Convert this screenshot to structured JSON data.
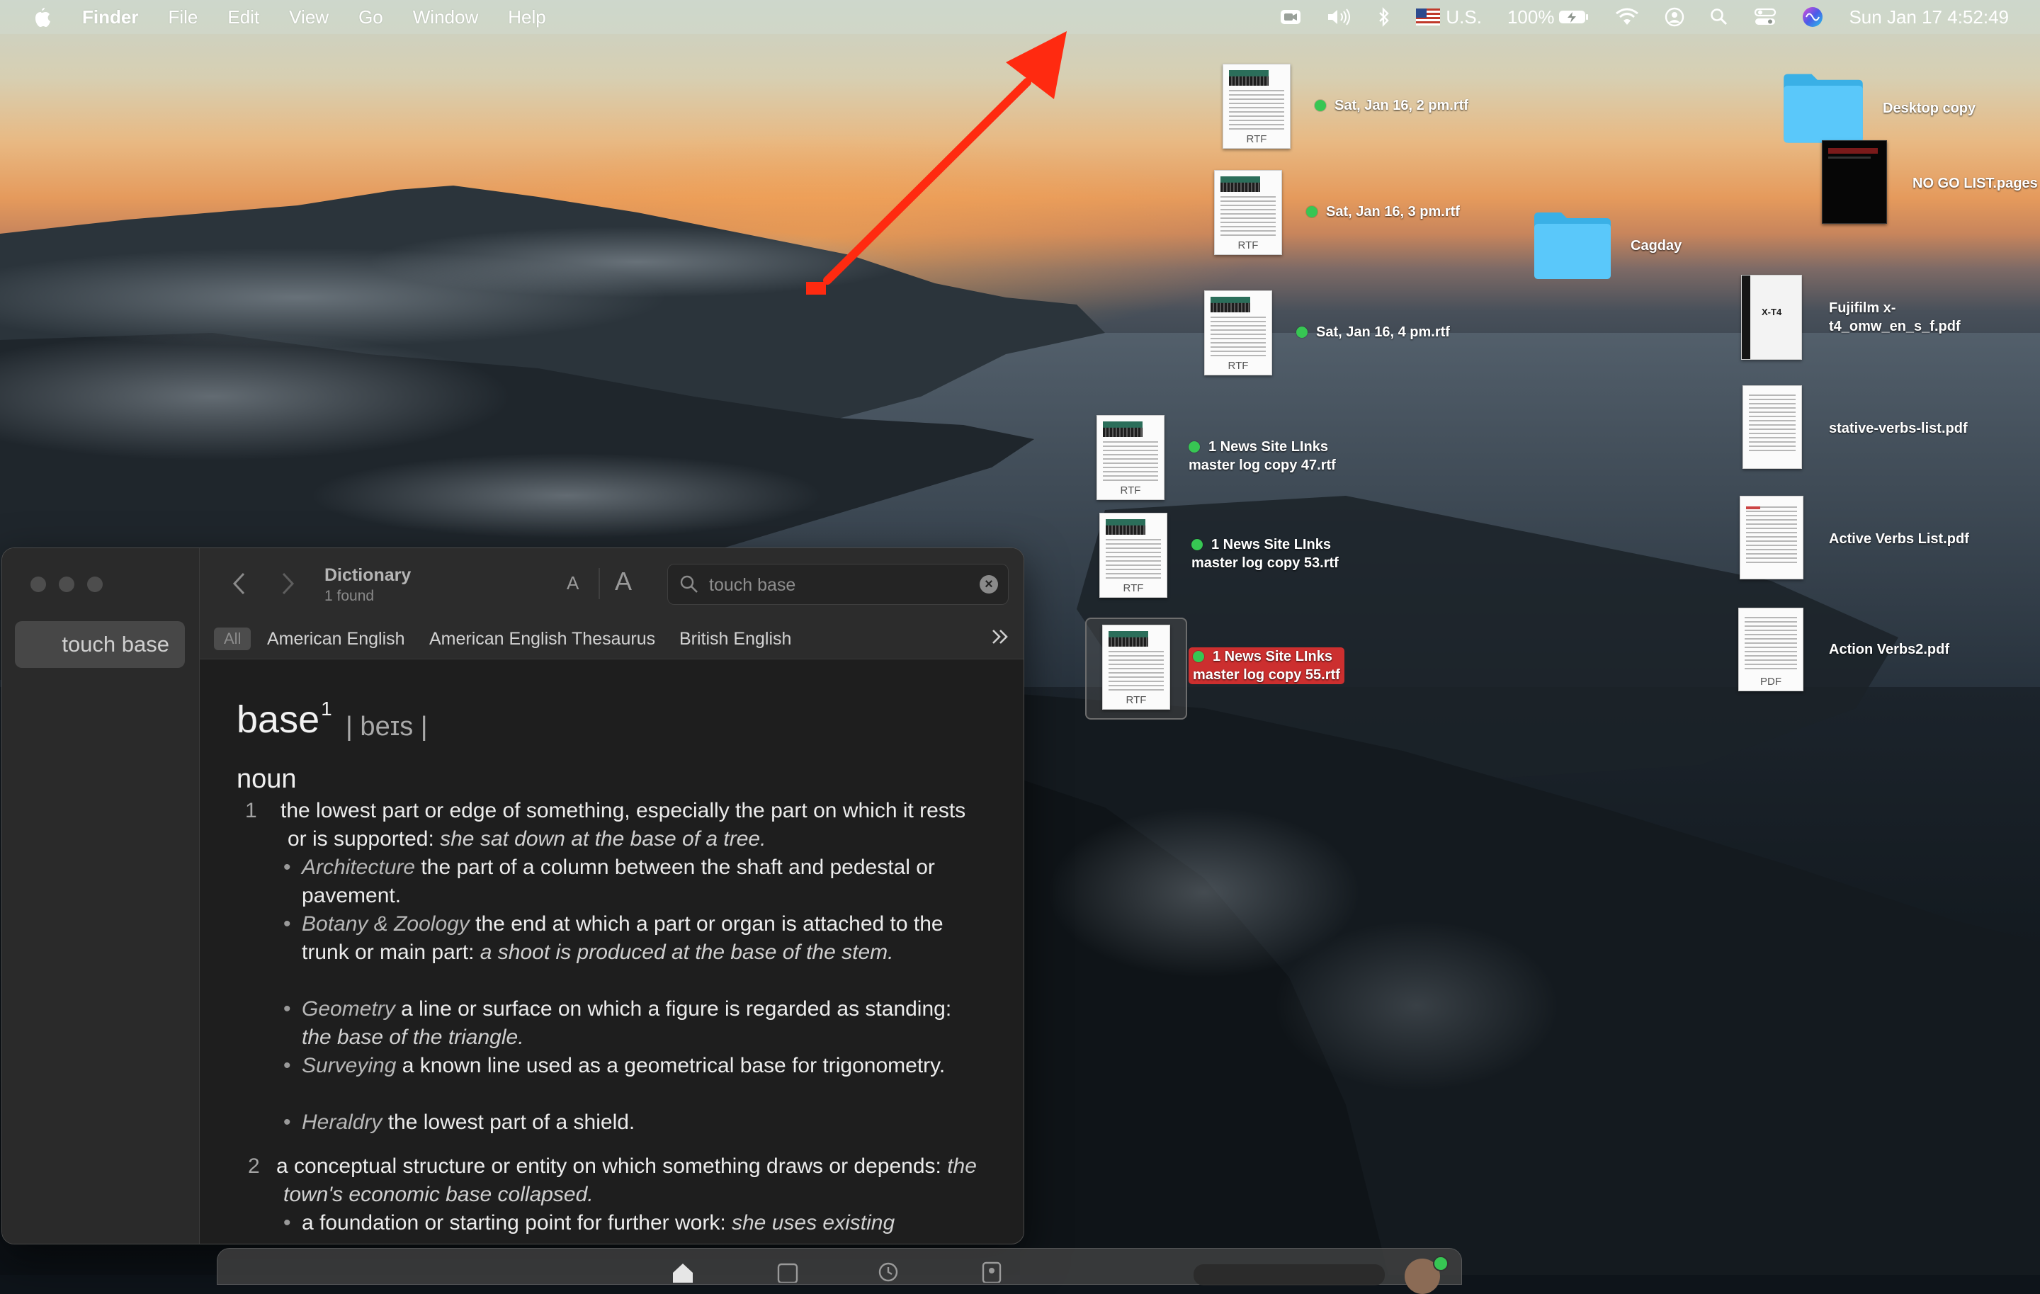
{
  "menubar": {
    "app_name": "Finder",
    "menus": [
      "File",
      "Edit",
      "View",
      "Go",
      "Window",
      "Help"
    ],
    "input_source": "U.S.",
    "battery": "100%",
    "clock": "Sun Jan 17  4:52:49"
  },
  "desktop": {
    "files": [
      {
        "label": "Sat, Jan 16, 2 pm.rtf",
        "ext": "RTF"
      },
      {
        "label": "Sat, Jan 16, 3 pm.rtf",
        "ext": "RTF"
      },
      {
        "label": "Sat, Jan 16, 4 pm.rtf",
        "ext": "RTF"
      },
      {
        "label_line1": "1 News Site LInks",
        "label_line2": "master log copy 47.rtf",
        "ext": "RTF"
      },
      {
        "label_line1": "1 News Site LInks",
        "label_line2": "master log copy 53.rtf",
        "ext": "RTF"
      },
      {
        "label_line1": "1 News Site LInks",
        "label_line2": "master log copy 55.rtf",
        "ext": "RTF"
      }
    ],
    "cagday_folder": "Cagday",
    "desktop_copy_folder": "Desktop copy",
    "no_go_list": "NO GO LIST.pages",
    "fujifilm_line1": "Fujifilm x-",
    "fujifilm_line2": "t4_omw_en_s_f.pdf",
    "fujifilm_thumb_text": "X-T4",
    "stative": "stative-verbs-list.pdf",
    "active": "Active Verbs List.pdf",
    "action": "Action Verbs2.pdf",
    "action_ext": "PDF"
  },
  "dictionary": {
    "sidebar_item": "touch base",
    "title": "Dictionary",
    "subtitle": "1 found",
    "font_small": "A",
    "font_large": "A",
    "search_value": "touch base",
    "tabs": [
      "All",
      "American English",
      "American English Thesaurus",
      "British English"
    ],
    "entry": {
      "headword": "base",
      "homograph": "1",
      "pronunciation": "| beɪs |",
      "part_of_speech": "noun",
      "def1": {
        "num": "1",
        "text": "the lowest part or edge of something, especially the part on which it rests or is supported:",
        "example": "she sat down at the base of a tree."
      },
      "subdefs": [
        {
          "field": "Architecture",
          "text": "the part of a column between the shaft and pedestal or pavement."
        },
        {
          "field": "Botany & Zoology",
          "text": "the end at which a part or organ is attached to the trunk or main part:",
          "example": "a shoot is produced at the base of the stem."
        },
        {
          "field": "Geometry",
          "text": "a line or surface on which a figure is regarded as standing:",
          "example": "the base of the triangle."
        },
        {
          "field": "Surveying",
          "text": "a known line used as a geometrical base for trigonometry."
        },
        {
          "field": "Heraldry",
          "text": "the lowest part of a shield."
        }
      ],
      "def2": {
        "num": "2",
        "text": "a conceptual structure or entity on which something draws or depends:",
        "example": "the town's economic base collapsed."
      },
      "def2_sub": {
        "text": "a foundation or starting point for further work:",
        "example": "she uses existing"
      }
    }
  },
  "colors": {
    "tag_green": "#37c653",
    "selection_red": "#cc2f2f",
    "arrow_red": "#ff2a10",
    "folder_blue": "#5ac8fa"
  }
}
